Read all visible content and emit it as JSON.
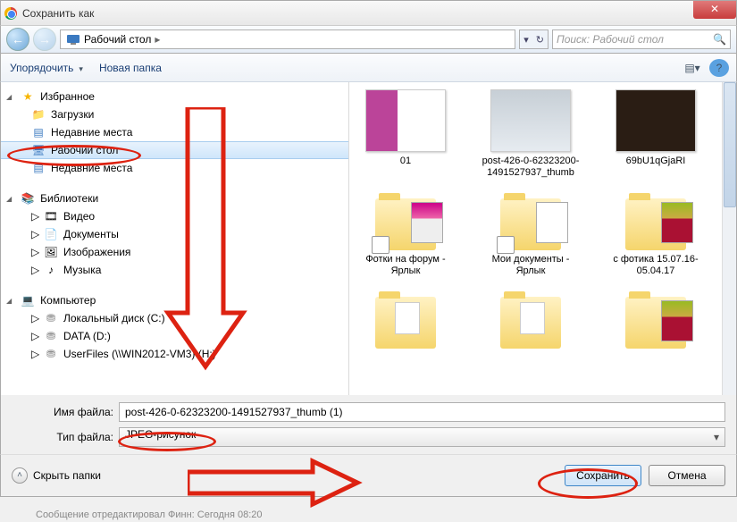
{
  "window": {
    "title": "Сохранить как"
  },
  "nav": {
    "location": "Рабочий стол",
    "search_placeholder": "Поиск: Рабочий стол"
  },
  "toolbar": {
    "organize": "Упорядочить",
    "new_folder": "Новая папка"
  },
  "tree": {
    "favorites": "Избранное",
    "downloads": "Загрузки",
    "recent1": "Недавние места",
    "desktop": "Рабочий стол",
    "recent2": "Недавние места",
    "libraries": "Библиотеки",
    "video": "Видео",
    "documents": "Документы",
    "pictures": "Изображения",
    "music": "Музыка",
    "computer": "Компьютер",
    "cdrive": "Локальный диск (C:)",
    "ddrive": "DATA (D:)",
    "netdrive": "UserFiles (\\\\WIN2012-VM3) (H:)"
  },
  "content": {
    "items": [
      {
        "caption": "01"
      },
      {
        "caption": "post-426-0-62323200-1491527937_thumb"
      },
      {
        "caption": "69bU1qGjaRI"
      },
      {
        "caption": "Фотки на форум - Ярлык"
      },
      {
        "caption": "Мои документы - Ярлык"
      },
      {
        "caption": "с фотика 15.07.16-05.04.17"
      }
    ]
  },
  "fields": {
    "filename_label": "Имя файла:",
    "filename_value": "post-426-0-62323200-1491527937_thumb (1)",
    "filetype_label": "Тип файла:",
    "filetype_value": "JPEG-рисунок"
  },
  "bottom": {
    "hide_folders": "Скрыть папки",
    "save": "Сохранить",
    "cancel": "Отмена"
  },
  "footer_cut": "Сообщение отредактировал Финн: Сегодня 08:20"
}
